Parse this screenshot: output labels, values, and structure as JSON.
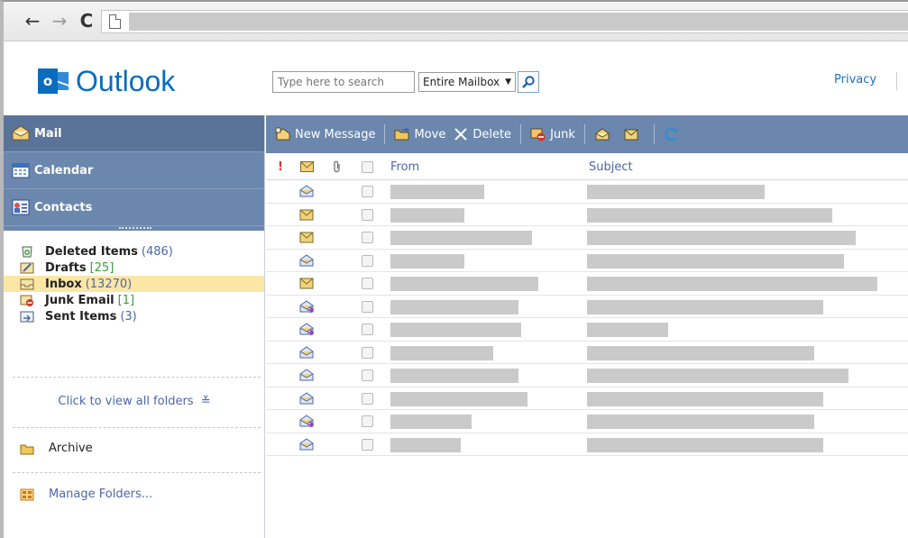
{
  "browser": {
    "back_icon": "arrow-left",
    "forward_icon": "arrow-right",
    "reload_icon": "reload",
    "address_value": ""
  },
  "header": {
    "logo_text": "Outlook",
    "search_placeholder": "Type here to search",
    "search_scope": "Entire Mailbox",
    "privacy_label": "Privacy"
  },
  "sidebar": {
    "nav": [
      {
        "label": "Mail"
      },
      {
        "label": "Calendar"
      },
      {
        "label": "Contacts"
      }
    ],
    "folders": [
      {
        "name": "Deleted Items",
        "count": "(486)",
        "count_style": "blue"
      },
      {
        "name": "Drafts",
        "count": "[25]",
        "count_style": "green"
      },
      {
        "name": "Inbox",
        "count": "(13270)",
        "count_style": "blue"
      },
      {
        "name": "Junk Email",
        "count": "[1]",
        "count_style": "green"
      },
      {
        "name": "Sent Items",
        "count": "(3)",
        "count_style": "blue"
      }
    ],
    "view_all_label": "Click to view all folders",
    "archive_label": "Archive",
    "manage_label": "Manage Folders..."
  },
  "toolbar": {
    "new_message": "New Message",
    "move": "Move",
    "delete": "Delete",
    "junk": "Junk"
  },
  "columns": {
    "importance": "!",
    "from": "From",
    "subject": "Subject"
  },
  "messages": [
    {
      "icon": "read-envelope",
      "from_redacted": true,
      "subject_redacted": true
    },
    {
      "icon": "unread-envelope",
      "from_redacted": true,
      "subject_redacted": true
    },
    {
      "icon": "unread-envelope",
      "from_redacted": true,
      "subject_redacted": true
    },
    {
      "icon": "read-envelope",
      "from_redacted": true,
      "subject_redacted": true
    },
    {
      "icon": "unread-envelope",
      "from_redacted": true,
      "subject_redacted": true
    },
    {
      "icon": "replied-envelope",
      "from_redacted": true,
      "subject_redacted": true
    },
    {
      "icon": "replied-envelope",
      "from_redacted": true,
      "subject_redacted": true
    },
    {
      "icon": "read-envelope",
      "from_redacted": true,
      "subject_redacted": true
    },
    {
      "icon": "read-envelope",
      "from_redacted": true,
      "subject_redacted": true
    },
    {
      "icon": "read-envelope",
      "from_redacted": true,
      "subject_redacted": true
    },
    {
      "icon": "replied-envelope",
      "from_redacted": true,
      "subject_redacted": true
    },
    {
      "icon": "read-envelope",
      "from_redacted": true,
      "subject_redacted": true
    }
  ],
  "colors": {
    "nav_blue": "#6c87ad",
    "brand_blue": "#0a6cbf",
    "link_blue": "#4b67a9",
    "selected_folder": "#fbe6a6"
  }
}
